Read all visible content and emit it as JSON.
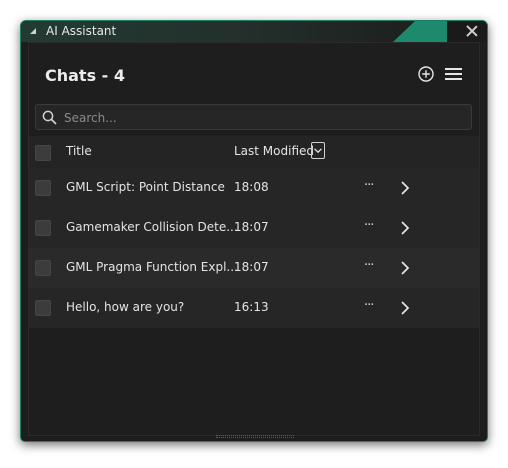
{
  "window": {
    "title": "AI Assistant",
    "accent_color": "#1e8a6d",
    "icons": {
      "collapse": "collapse-triangle-icon",
      "close": "close-icon"
    }
  },
  "header": {
    "title": "Chats - 4",
    "icons": {
      "new_chat": "add-circle-icon",
      "menu": "hamburger-menu-icon"
    }
  },
  "search": {
    "placeholder": "Search...",
    "value": "",
    "icon": "search-icon"
  },
  "table": {
    "columns": {
      "title": "Title",
      "modified": "Last Modified"
    },
    "sort_icon": "chevron-down-icon",
    "rows": [
      {
        "title": "GML Script: Point Distance",
        "modified": "18:08",
        "more": "···"
      },
      {
        "title": "Gamemaker Collision Dete...",
        "modified": "18:07",
        "more": "···"
      },
      {
        "title": "GML Pragma Function Expl...",
        "modified": "18:07",
        "more": "···"
      },
      {
        "title": "Hello, how are you?",
        "modified": "16:13",
        "more": "···"
      }
    ]
  }
}
